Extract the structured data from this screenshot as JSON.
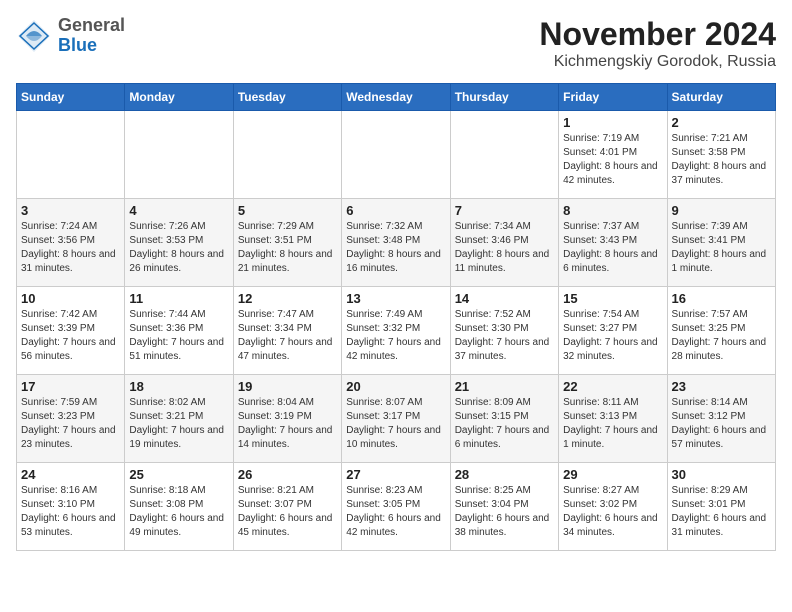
{
  "logo": {
    "general": "General",
    "blue": "Blue"
  },
  "title": {
    "month_year": "November 2024",
    "location": "Kichmengskiy Gorodok, Russia"
  },
  "weekdays": [
    "Sunday",
    "Monday",
    "Tuesday",
    "Wednesday",
    "Thursday",
    "Friday",
    "Saturday"
  ],
  "weeks": [
    [
      {
        "day": "",
        "sunrise": "",
        "sunset": "",
        "daylight": ""
      },
      {
        "day": "",
        "sunrise": "",
        "sunset": "",
        "daylight": ""
      },
      {
        "day": "",
        "sunrise": "",
        "sunset": "",
        "daylight": ""
      },
      {
        "day": "",
        "sunrise": "",
        "sunset": "",
        "daylight": ""
      },
      {
        "day": "",
        "sunrise": "",
        "sunset": "",
        "daylight": ""
      },
      {
        "day": "1",
        "sunrise": "Sunrise: 7:19 AM",
        "sunset": "Sunset: 4:01 PM",
        "daylight": "Daylight: 8 hours and 42 minutes."
      },
      {
        "day": "2",
        "sunrise": "Sunrise: 7:21 AM",
        "sunset": "Sunset: 3:58 PM",
        "daylight": "Daylight: 8 hours and 37 minutes."
      }
    ],
    [
      {
        "day": "3",
        "sunrise": "Sunrise: 7:24 AM",
        "sunset": "Sunset: 3:56 PM",
        "daylight": "Daylight: 8 hours and 31 minutes."
      },
      {
        "day": "4",
        "sunrise": "Sunrise: 7:26 AM",
        "sunset": "Sunset: 3:53 PM",
        "daylight": "Daylight: 8 hours and 26 minutes."
      },
      {
        "day": "5",
        "sunrise": "Sunrise: 7:29 AM",
        "sunset": "Sunset: 3:51 PM",
        "daylight": "Daylight: 8 hours and 21 minutes."
      },
      {
        "day": "6",
        "sunrise": "Sunrise: 7:32 AM",
        "sunset": "Sunset: 3:48 PM",
        "daylight": "Daylight: 8 hours and 16 minutes."
      },
      {
        "day": "7",
        "sunrise": "Sunrise: 7:34 AM",
        "sunset": "Sunset: 3:46 PM",
        "daylight": "Daylight: 8 hours and 11 minutes."
      },
      {
        "day": "8",
        "sunrise": "Sunrise: 7:37 AM",
        "sunset": "Sunset: 3:43 PM",
        "daylight": "Daylight: 8 hours and 6 minutes."
      },
      {
        "day": "9",
        "sunrise": "Sunrise: 7:39 AM",
        "sunset": "Sunset: 3:41 PM",
        "daylight": "Daylight: 8 hours and 1 minute."
      }
    ],
    [
      {
        "day": "10",
        "sunrise": "Sunrise: 7:42 AM",
        "sunset": "Sunset: 3:39 PM",
        "daylight": "Daylight: 7 hours and 56 minutes."
      },
      {
        "day": "11",
        "sunrise": "Sunrise: 7:44 AM",
        "sunset": "Sunset: 3:36 PM",
        "daylight": "Daylight: 7 hours and 51 minutes."
      },
      {
        "day": "12",
        "sunrise": "Sunrise: 7:47 AM",
        "sunset": "Sunset: 3:34 PM",
        "daylight": "Daylight: 7 hours and 47 minutes."
      },
      {
        "day": "13",
        "sunrise": "Sunrise: 7:49 AM",
        "sunset": "Sunset: 3:32 PM",
        "daylight": "Daylight: 7 hours and 42 minutes."
      },
      {
        "day": "14",
        "sunrise": "Sunrise: 7:52 AM",
        "sunset": "Sunset: 3:30 PM",
        "daylight": "Daylight: 7 hours and 37 minutes."
      },
      {
        "day": "15",
        "sunrise": "Sunrise: 7:54 AM",
        "sunset": "Sunset: 3:27 PM",
        "daylight": "Daylight: 7 hours and 32 minutes."
      },
      {
        "day": "16",
        "sunrise": "Sunrise: 7:57 AM",
        "sunset": "Sunset: 3:25 PM",
        "daylight": "Daylight: 7 hours and 28 minutes."
      }
    ],
    [
      {
        "day": "17",
        "sunrise": "Sunrise: 7:59 AM",
        "sunset": "Sunset: 3:23 PM",
        "daylight": "Daylight: 7 hours and 23 minutes."
      },
      {
        "day": "18",
        "sunrise": "Sunrise: 8:02 AM",
        "sunset": "Sunset: 3:21 PM",
        "daylight": "Daylight: 7 hours and 19 minutes."
      },
      {
        "day": "19",
        "sunrise": "Sunrise: 8:04 AM",
        "sunset": "Sunset: 3:19 PM",
        "daylight": "Daylight: 7 hours and 14 minutes."
      },
      {
        "day": "20",
        "sunrise": "Sunrise: 8:07 AM",
        "sunset": "Sunset: 3:17 PM",
        "daylight": "Daylight: 7 hours and 10 minutes."
      },
      {
        "day": "21",
        "sunrise": "Sunrise: 8:09 AM",
        "sunset": "Sunset: 3:15 PM",
        "daylight": "Daylight: 7 hours and 6 minutes."
      },
      {
        "day": "22",
        "sunrise": "Sunrise: 8:11 AM",
        "sunset": "Sunset: 3:13 PM",
        "daylight": "Daylight: 7 hours and 1 minute."
      },
      {
        "day": "23",
        "sunrise": "Sunrise: 8:14 AM",
        "sunset": "Sunset: 3:12 PM",
        "daylight": "Daylight: 6 hours and 57 minutes."
      }
    ],
    [
      {
        "day": "24",
        "sunrise": "Sunrise: 8:16 AM",
        "sunset": "Sunset: 3:10 PM",
        "daylight": "Daylight: 6 hours and 53 minutes."
      },
      {
        "day": "25",
        "sunrise": "Sunrise: 8:18 AM",
        "sunset": "Sunset: 3:08 PM",
        "daylight": "Daylight: 6 hours and 49 minutes."
      },
      {
        "day": "26",
        "sunrise": "Sunrise: 8:21 AM",
        "sunset": "Sunset: 3:07 PM",
        "daylight": "Daylight: 6 hours and 45 minutes."
      },
      {
        "day": "27",
        "sunrise": "Sunrise: 8:23 AM",
        "sunset": "Sunset: 3:05 PM",
        "daylight": "Daylight: 6 hours and 42 minutes."
      },
      {
        "day": "28",
        "sunrise": "Sunrise: 8:25 AM",
        "sunset": "Sunset: 3:04 PM",
        "daylight": "Daylight: 6 hours and 38 minutes."
      },
      {
        "day": "29",
        "sunrise": "Sunrise: 8:27 AM",
        "sunset": "Sunset: 3:02 PM",
        "daylight": "Daylight: 6 hours and 34 minutes."
      },
      {
        "day": "30",
        "sunrise": "Sunrise: 8:29 AM",
        "sunset": "Sunset: 3:01 PM",
        "daylight": "Daylight: 6 hours and 31 minutes."
      }
    ]
  ]
}
